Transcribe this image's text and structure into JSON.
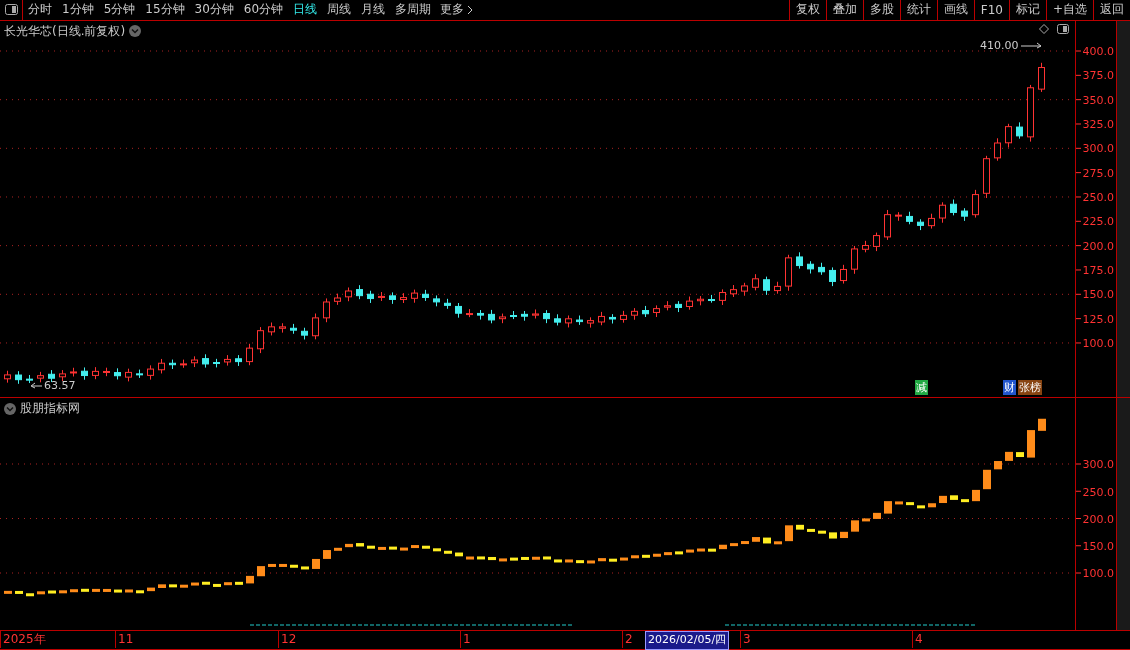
{
  "toolbar": {
    "periods": [
      {
        "label": "分时",
        "selected": false
      },
      {
        "label": "1分钟",
        "selected": false
      },
      {
        "label": "5分钟",
        "selected": false
      },
      {
        "label": "15分钟",
        "selected": false
      },
      {
        "label": "30分钟",
        "selected": false
      },
      {
        "label": "60分钟",
        "selected": false
      },
      {
        "label": "日线",
        "selected": true
      },
      {
        "label": "周线",
        "selected": false
      },
      {
        "label": "月线",
        "selected": false
      },
      {
        "label": "多周期",
        "selected": false
      }
    ],
    "more": "更多",
    "buttons": [
      "复权",
      "叠加",
      "多股",
      "统计",
      "画线",
      "F10",
      "标记",
      "+自选",
      "返回"
    ]
  },
  "main_chart": {
    "title": "长光华芯(日线.前复权)",
    "high_label": "410.00",
    "low_label": "63.57",
    "y_axis": [
      "400.0",
      "375.0",
      "350.0",
      "325.0",
      "300.0",
      "275.0",
      "250.0",
      "225.0",
      "200.0",
      "175.0",
      "150.0",
      "125.0",
      "100.0"
    ],
    "badges": [
      {
        "text": "减",
        "color": "#22aa44"
      },
      {
        "text": "财",
        "color": "#2255cc"
      },
      {
        "text": "张榜",
        "color": "#884411"
      }
    ]
  },
  "indicator": {
    "title": "股朋指标网",
    "y_axis": [
      "300.0",
      "250.0",
      "200.0",
      "150.0",
      "100.0"
    ]
  },
  "date_axis": [
    {
      "label": "2025年",
      "selected": false
    },
    {
      "label": "11",
      "selected": false
    },
    {
      "label": "12",
      "selected": false
    },
    {
      "label": "1",
      "selected": false
    },
    {
      "label": "2",
      "selected": false
    },
    {
      "label": "2026/02/05/四",
      "selected": true
    },
    {
      "label": "3",
      "selected": false
    },
    {
      "label": "4",
      "selected": false
    }
  ]
}
